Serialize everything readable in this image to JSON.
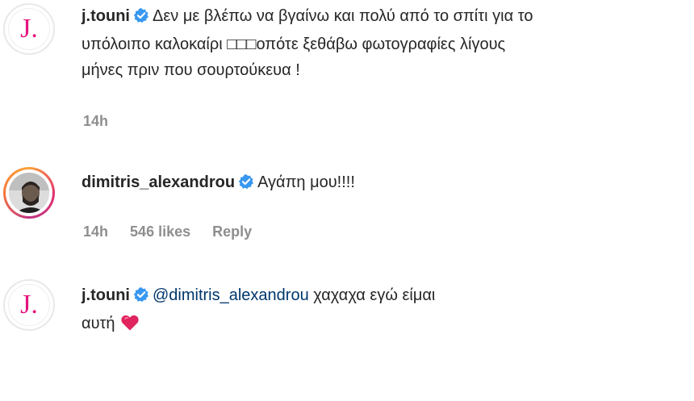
{
  "comments": [
    {
      "username": "j.touni",
      "avatar_letter": "J.",
      "text": "Δεν με βλέπω να βγαίνω και πολύ από το σπίτι για το υπόλοιπο καλοκαίρι □□□οπότε ξεθάβω φωτογραφίες λίγους μήνες πριν που σουρτούκευα !",
      "line1": "Δεν με βλέπω να βγαίνω και πολύ από το σπίτι για το",
      "line2": "υπόλοιπο καλοκαίρι □□□οπότε ξεθάβω φωτογραφίες λίγους",
      "line3": "μήνες πριν που σουρτούκευα !",
      "time": "14h"
    },
    {
      "username": "dimitris_alexandrou",
      "text": "Αγάπη μου!!!!",
      "time": "14h",
      "likes": "546 likes",
      "reply_label": "Reply"
    },
    {
      "username": "j.touni",
      "avatar_letter": "J.",
      "mention": "@dimitris_alexandrou",
      "text_after_mention": " χαχαχα εγώ είμαι",
      "line2": "αυτή",
      "emoji": "heart-emoji"
    }
  ],
  "colors": {
    "verified_blue": "#3897f0",
    "meta_gray": "#8e8e8e",
    "mention_blue": "#00376b",
    "brand_pink": "#e4157e",
    "heart_red": "#e0245e"
  }
}
